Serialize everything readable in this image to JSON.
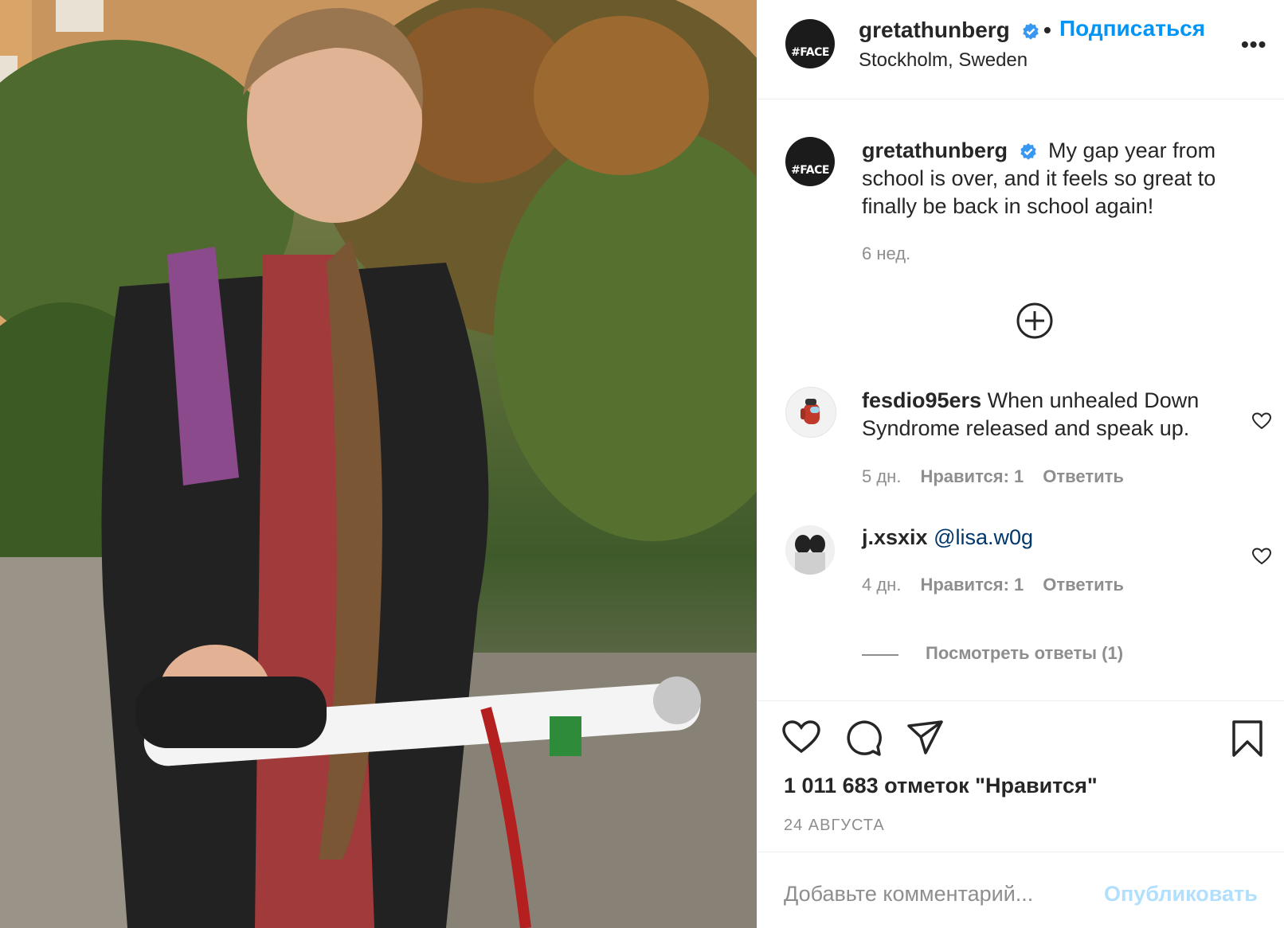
{
  "header": {
    "username": "gretathunberg",
    "follow_label": "Подписаться",
    "location": "Stockholm, Sweden",
    "more_label": "•••"
  },
  "post": {
    "avatar_text": "#FACE",
    "caption_user": "gretathunberg",
    "caption_text": "My gap year from school is over, and it feels so great to finally be back in school again!",
    "caption_age": "6 нед."
  },
  "comments": [
    {
      "user": "fesdio95ers",
      "text": "When unhealed Down Syndrome released and speak up.",
      "age": "5 дн.",
      "likes": "Нравится: 1",
      "reply": "Ответить"
    },
    {
      "user": "j.xsxix",
      "text": "@lisa.w0g",
      "age": "4 дн.",
      "likes": "Нравится: 1",
      "reply": "Ответить"
    }
  ],
  "view_replies_label": "Посмотреть ответы (1)",
  "likes_count": "1 011 683 отметок \"Нравится\"",
  "date": "24 АВГУСТА",
  "comment_input": {
    "placeholder": "Добавьте комментарий...",
    "publish_label": "Опубликовать"
  },
  "icons": [
    "verified-badge-icon",
    "more-icon",
    "load-more-comments-icon",
    "comment-heart-icon",
    "heart-icon",
    "comment-icon",
    "share-icon",
    "bookmark-icon"
  ],
  "colors": {
    "link": "#0095f6",
    "verified": "#3897f0",
    "muted": "#8e8e8e",
    "publish_disabled": "#b2dffc",
    "mention": "#00376b"
  }
}
